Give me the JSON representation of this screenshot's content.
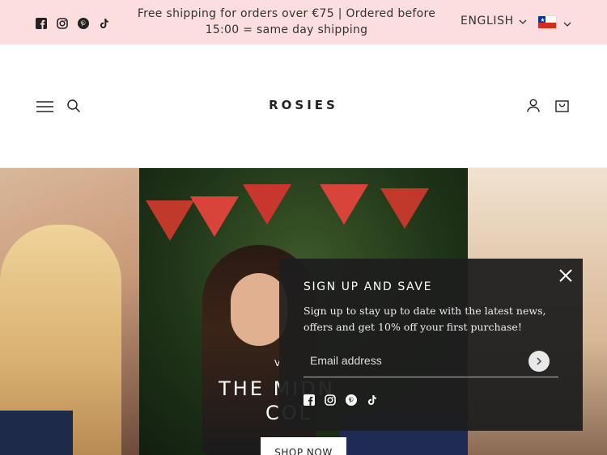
{
  "announcement": {
    "text": "Free shipping for orders over €75  | Ordered before 15:00 = same day shipping",
    "social_icons": [
      "facebook-icon",
      "instagram-icon",
      "pinterest-icon",
      "tiktok-icon"
    ]
  },
  "locale": {
    "language": "ENGLISH",
    "country_flag": "chile-flag"
  },
  "header": {
    "logo": "ROSIES",
    "left_icons": [
      "menu-icon",
      "search-icon"
    ],
    "right_icons": [
      "account-icon",
      "cart-icon"
    ]
  },
  "hero": {
    "subtitle": "V",
    "title_line1": "THE MIDN",
    "title_line2": "COL",
    "button_label": "SHOP NOW"
  },
  "popup": {
    "title": "SIGN UP AND SAVE",
    "text": "Sign up to stay up to date with the latest news, offers and get 10% off your first purchase!",
    "email_placeholder": "Email address",
    "social_icons": [
      "facebook-icon",
      "instagram-icon",
      "pinterest-icon",
      "tiktok-icon"
    ]
  },
  "colors": {
    "topbar_bg": "#fcdede",
    "popup_bg": "#1e1e1e",
    "text_dark": "#333333"
  }
}
